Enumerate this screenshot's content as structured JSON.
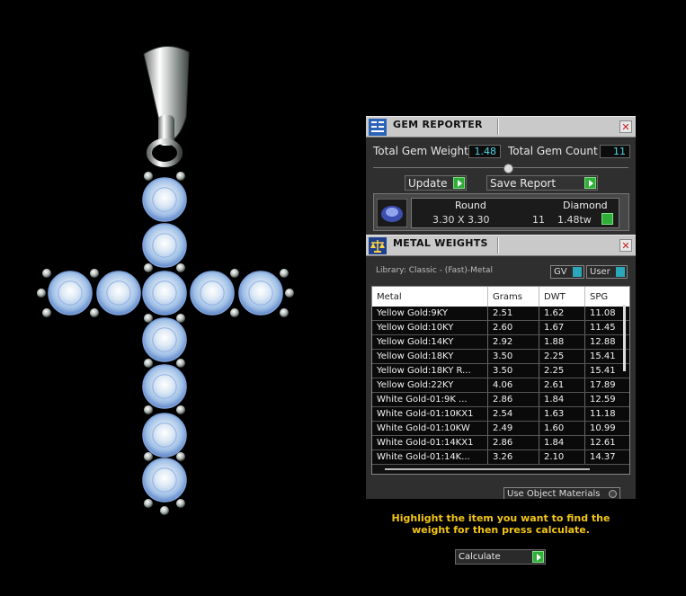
{
  "viewport": {
    "icons": {
      "viewport_object": "cross-pendant"
    },
    "colors": {
      "background": "#000000",
      "gem": "#cfe6ff",
      "metal": "#dfe6e3"
    }
  },
  "gem_reporter": {
    "title": "GEM REPORTER",
    "total_weight_label": "Total Gem Weight",
    "total_weight_value": "1.48",
    "total_count_label": "Total Gem Count",
    "total_count_value": "11",
    "update_label": "Update",
    "save_report_label": "Save Report",
    "table": {
      "shape": "Round",
      "stone": "Diamond",
      "size": "3.30 X 3.30",
      "count": "11",
      "weight": "1.48tw"
    }
  },
  "metal_weights": {
    "title": "METAL WEIGHTS",
    "library": "Library: Classic - (Fast)-Metal",
    "gv_label": "GV",
    "user_label": "User",
    "columns": [
      "Metal",
      "Grams",
      "DWT",
      "SPG"
    ],
    "rows": [
      [
        "Yellow Gold:9KY",
        "2.51",
        "1.62",
        "11.08"
      ],
      [
        "Yellow Gold:10KY",
        "2.60",
        "1.67",
        "11.45"
      ],
      [
        "Yellow Gold:14KY",
        "2.92",
        "1.88",
        "12.88"
      ],
      [
        "Yellow Gold:18KY",
        "3.50",
        "2.25",
        "15.41"
      ],
      [
        "Yellow Gold:18KY R...",
        "3.50",
        "2.25",
        "15.41"
      ],
      [
        "Yellow Gold:22KY",
        "4.06",
        "2.61",
        "17.89"
      ],
      [
        "White Gold-01:9K ...",
        "2.86",
        "1.84",
        "12.59"
      ],
      [
        "White Gold-01:10KX1",
        "2.54",
        "1.63",
        "11.18"
      ],
      [
        "White Gold-01:10KW",
        "2.49",
        "1.60",
        "10.99"
      ],
      [
        "White Gold-01:14KX1",
        "2.86",
        "1.84",
        "12.61"
      ],
      [
        "White Gold-01:14K...",
        "3.26",
        "2.10",
        "14.37"
      ]
    ],
    "use_object_materials_label": "Use Object Materials",
    "instruction": "Highlight the item you want to find the weight for then press calculate.",
    "calculate_label": "Calculate"
  }
}
